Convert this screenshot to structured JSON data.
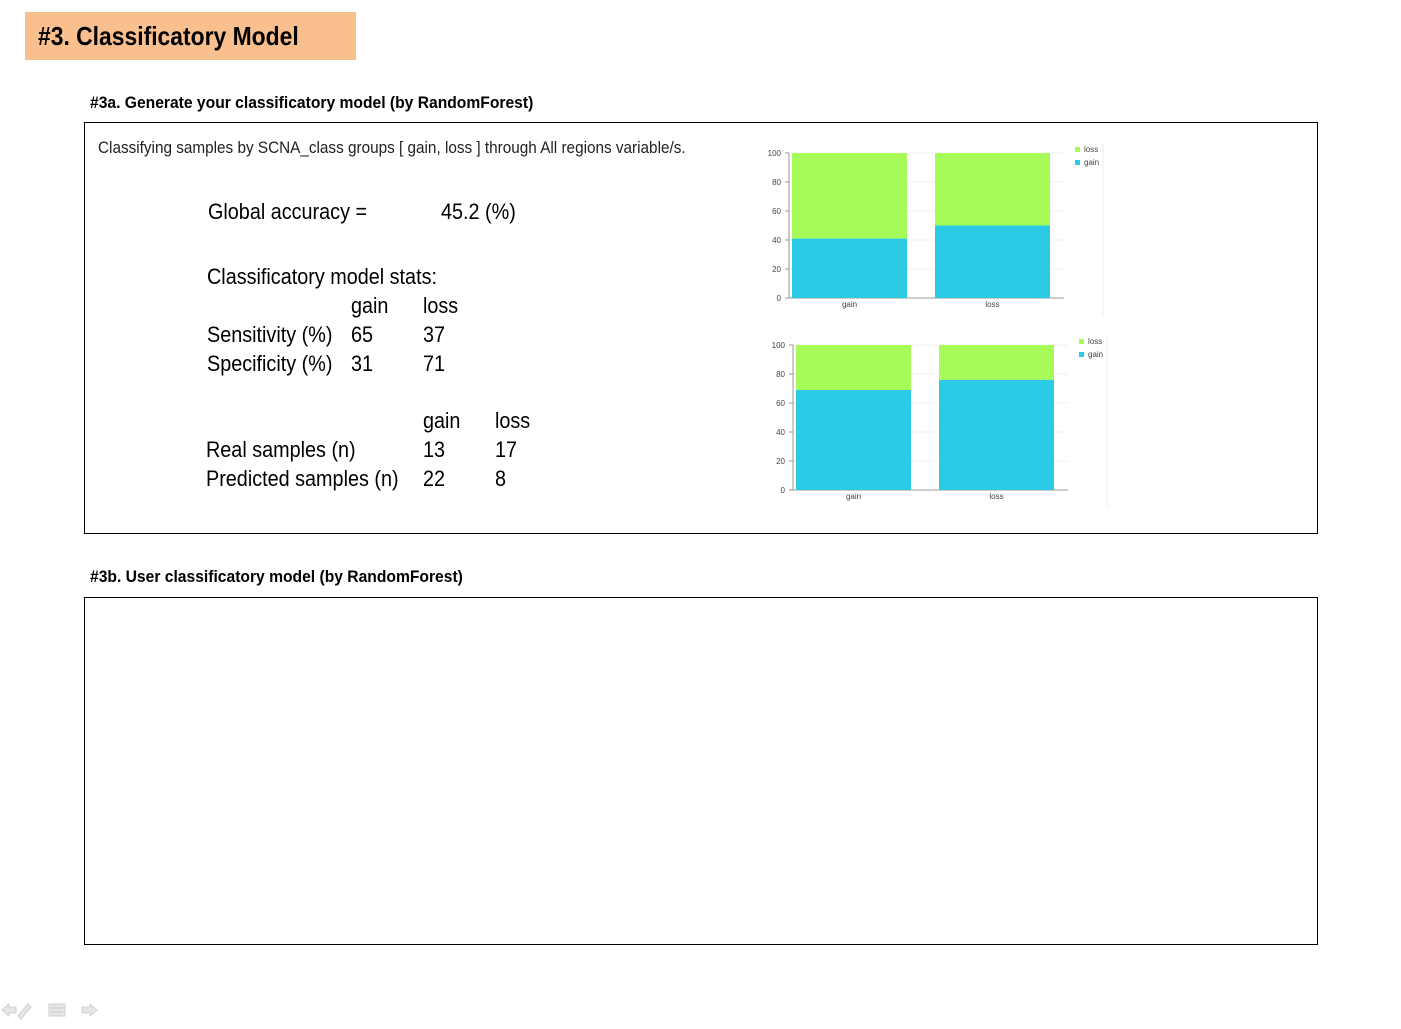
{
  "page_title": "#3. Classificatory Model",
  "section_a": {
    "heading": "#3a. Generate your classificatory  model (by RandomForest)",
    "description": "Classifying samples by SCNA_class groups [ gain, loss ] through All regions variable/s.",
    "global_accuracy_label": "Global accuracy =",
    "global_accuracy_value": "45.2 (%)",
    "stats_title": "Classificatory model stats:",
    "stats_headers": [
      "gain",
      "loss"
    ],
    "sensitivity_label": "Sensitivity  (%)",
    "sensitivity_values": [
      "65",
      "37"
    ],
    "specificity_label": "Specificity  (%)",
    "specificity_values": [
      "31",
      "71"
    ],
    "samples_headers": [
      "gain",
      "loss"
    ],
    "real_label": "Real samples (n)",
    "real_values": [
      "13",
      "17"
    ],
    "predicted_label": "Predicted samples (n)",
    "predicted_values": [
      "22",
      "8"
    ]
  },
  "section_b": {
    "heading": "#3b. User classificatory model (by RandomForest)"
  },
  "colors": {
    "gain": "#2bcbe5",
    "loss": "#a6fb58",
    "title_bg": "#f9bf8f"
  },
  "chart_data": [
    {
      "type": "bar",
      "stacked": true,
      "categories": [
        "gain",
        "loss"
      ],
      "series": [
        {
          "name": "gain",
          "values": [
            41,
            50
          ]
        },
        {
          "name": "loss",
          "values": [
            59,
            50
          ]
        }
      ],
      "yticks": [
        "0",
        "20",
        "40",
        "60",
        "80",
        "100"
      ],
      "ylim": [
        0,
        100
      ],
      "legend": "top-right"
    },
    {
      "type": "bar",
      "stacked": true,
      "categories": [
        "gain",
        "loss"
      ],
      "series": [
        {
          "name": "gain",
          "values": [
            69,
            76
          ]
        },
        {
          "name": "loss",
          "values": [
            31,
            24
          ]
        }
      ],
      "yticks": [
        "0",
        "20",
        "40",
        "60",
        "80",
        "100"
      ],
      "ylim": [
        0,
        100
      ],
      "legend": "top-right"
    }
  ]
}
